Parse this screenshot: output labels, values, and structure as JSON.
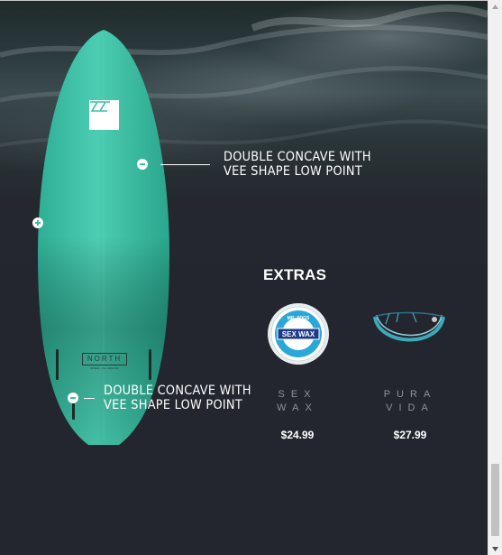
{
  "product_page": {
    "board": {
      "logo_icon": "north-logo-icon",
      "brand_mark": "NORTH",
      "brand_mark_sub": "SPEED - ALL AROUND",
      "color": "#3fbfa6"
    },
    "callouts": [
      {
        "line1": "DOUBLE CONCAVE WITH",
        "line2": "VEE SHAPE LOW POINT"
      },
      {
        "line1": "DOUBLE CONCAVE WITH",
        "line2": "VEE SHAPE LOW POINT"
      }
    ],
    "hotspots": [
      {
        "type": "minus"
      },
      {
        "type": "plus"
      },
      {
        "type": "minus"
      }
    ],
    "extras": {
      "title": "EXTRAS",
      "items": [
        {
          "name_line1": "SEX",
          "name_line2": "WAX",
          "price": "$24.99",
          "label_text": "SEX WAX",
          "label_top": "MR. ZOGS",
          "icon": "wax-puck-icon"
        },
        {
          "name_line1": "PURA",
          "name_line2": "VIDA",
          "price": "$27.99",
          "icon": "bracelet-icon"
        }
      ]
    }
  },
  "scrollbar": {
    "up_icon": "arrow-up-icon",
    "down_icon": "arrow-down-icon"
  }
}
